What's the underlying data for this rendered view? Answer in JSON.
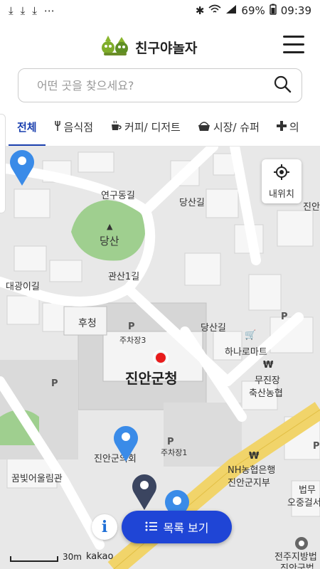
{
  "status": {
    "left_icons": [
      "download-icon",
      "download-icon",
      "download-icon",
      "more-dots-icon"
    ],
    "battery": "69%",
    "time": "09:39"
  },
  "header": {
    "app_title": "친구야놀자"
  },
  "search": {
    "placeholder": "어떤 곳을 찾으세요?"
  },
  "tabs": [
    {
      "label": "전체",
      "icon": ""
    },
    {
      "label": "음식점",
      "icon": "fork-icon"
    },
    {
      "label": "커피/ 디저트",
      "icon": "cup-icon"
    },
    {
      "label": "시장/ 슈퍼",
      "icon": "basket-icon"
    },
    {
      "label": "의",
      "icon": "plus-icon"
    }
  ],
  "map": {
    "locate_label": "내위치",
    "labels": {
      "dangsan": "당산",
      "yeongu_road": "연구동길",
      "gwansan_road": "관산1길",
      "dangsan_road_top": "당산길",
      "dangsan_road_mid": "당산길",
      "hucheong": "후청",
      "parking3": "주차장3",
      "county_office": "진안군청",
      "hanaro_mart": "하나로마트",
      "mujinjang": "무진장",
      "livestock_coop": "축산농협",
      "county_council": "진안군의회",
      "parking1": "주차장1",
      "nh_bank": "NH농협은행",
      "nh_branch": "진안군지부",
      "flower_hall": "꿈빛어울림관",
      "right_edge_top": "진안",
      "right_edge_law": "법무",
      "right_edge_ojeong": "오중걸서",
      "court": "전주지방법",
      "court2": "진안군법",
      "daepyeong_road": "대광이길"
    },
    "list_button": "목록 보기",
    "info": "i",
    "scale_label": "30m",
    "provider": "kakao"
  },
  "colors": {
    "accent": "#1f45d6",
    "tab_active": "#1a3fae",
    "pin_blue": "#3a8be8",
    "pin_dark": "#3b4560",
    "park_green": "#9fcf8f",
    "main_road": "#f1d46a"
  }
}
